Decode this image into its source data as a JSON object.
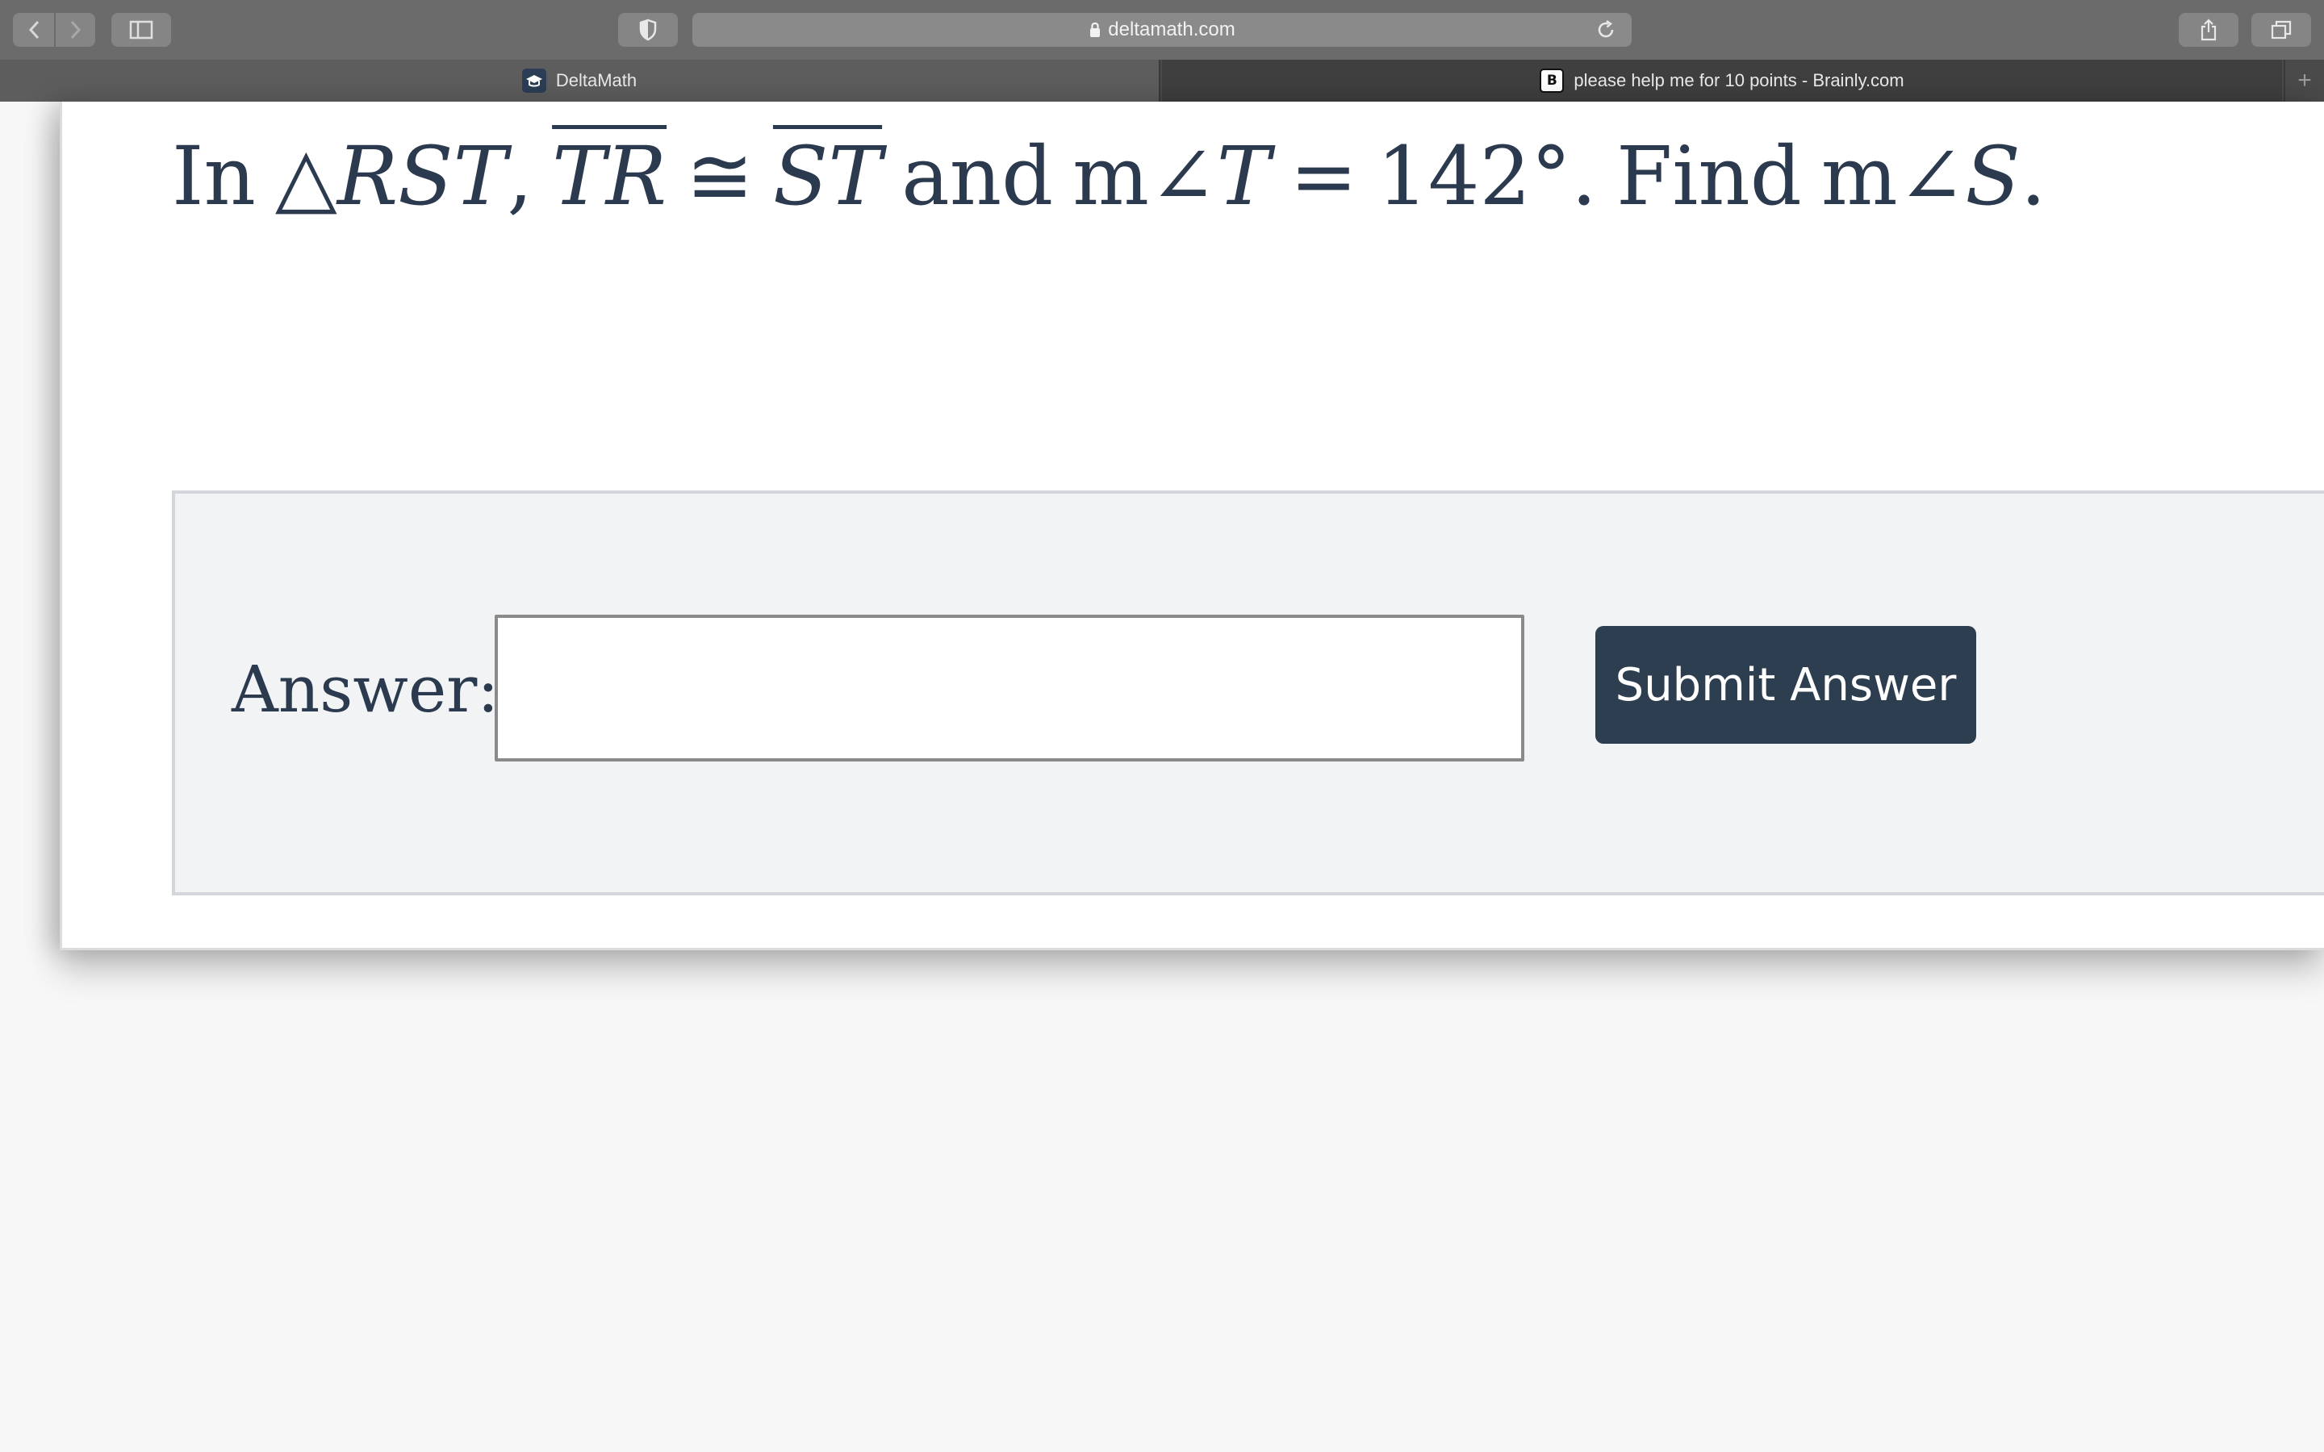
{
  "browser": {
    "url": "deltamath.com",
    "tabs": [
      {
        "title": "DeltaMath",
        "favicon": "deltamath-logo-icon"
      },
      {
        "title": "please help me for 10 points - Brainly.com",
        "favicon": "brainly-logo-icon",
        "favicon_letter": "B"
      }
    ],
    "new_tab_symbol": "+"
  },
  "problem": {
    "prefix": "In",
    "triangle_symbol": "△",
    "triangle_name": "RST",
    "comma": ",",
    "segment_1": "TR",
    "congruent_symbol": "≅",
    "segment_2": "ST",
    "and_word": "and",
    "angle_given": "m∠",
    "angle_given_vertex": "T",
    "equals": "=",
    "angle_value": "142°.",
    "find_word": "Find",
    "angle_find": "m∠",
    "angle_find_vertex": "S",
    "period": "."
  },
  "answer": {
    "label": "Answer:",
    "input_value": "",
    "submit_label": "Submit Answer"
  },
  "colors": {
    "text": "#2b3a4e",
    "submit_bg": "#2c3e50",
    "panel_bg": "#f1f3f5"
  }
}
